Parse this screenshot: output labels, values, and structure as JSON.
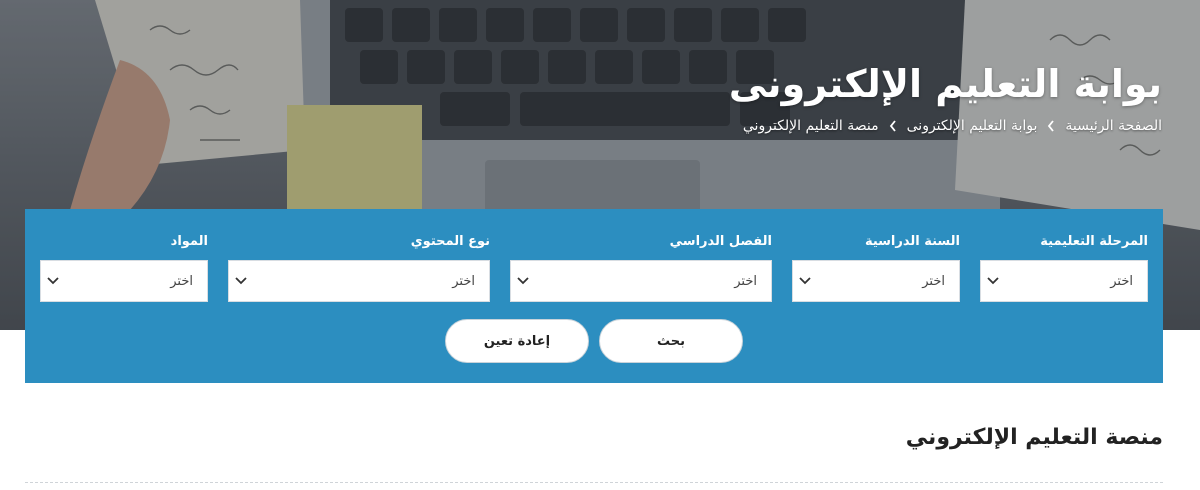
{
  "hero": {
    "title": "بوابة التعليم الإلكترونى",
    "breadcrumb": [
      "الصفحة الرئيسية",
      "بوابة التعليم الإلكترونى",
      "منصة التعليم الإلكتروني"
    ]
  },
  "filters": {
    "fields": [
      {
        "label": "المرحلة التعليمية",
        "value": "اختر"
      },
      {
        "label": "السنة الدراسية",
        "value": "اختر"
      },
      {
        "label": "الفصل الدراسي",
        "value": "اختر"
      },
      {
        "label": "نوع المحتوي",
        "value": "اختر"
      },
      {
        "label": "المواد",
        "value": "اختر"
      }
    ],
    "search_label": "بحث",
    "reset_label": "إعادة تعين"
  },
  "section": {
    "title": "منصة التعليم الإلكتروني"
  },
  "colors": {
    "panel": "#2c8ec0",
    "hero_overlay": "#5c6168"
  },
  "icons": {
    "breadcrumb_separator": "chevron-right-icon",
    "select_arrow": "chevron-down-icon"
  }
}
